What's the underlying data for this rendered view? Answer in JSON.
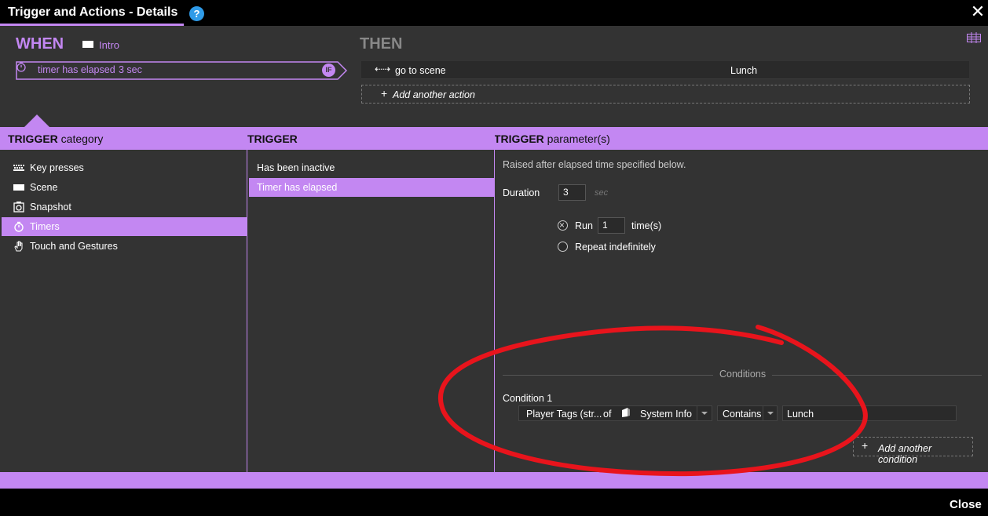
{
  "window": {
    "title": "Trigger and Actions - Details",
    "help_icon": "?",
    "close_icon": "✕"
  },
  "when": {
    "heading": "WHEN",
    "scene_name": "Intro",
    "trigger_label": "timer has elapsed",
    "trigger_value": "3 sec",
    "if_badge": "IF"
  },
  "then": {
    "heading": "THEN",
    "action_icon": "⇠⇢",
    "action_label": "go to scene",
    "action_value": "Lunch",
    "add_action": "Add another action"
  },
  "headers": {
    "category_bold": "TRIGGER",
    "category_rest": "category",
    "trigger_bold": "TRIGGER",
    "params_bold": "TRIGGER",
    "params_rest": "parameter(s)"
  },
  "categories": [
    {
      "label": "Key presses",
      "icon": "keyboard-icon",
      "selected": false
    },
    {
      "label": "Scene",
      "icon": "scene-icon",
      "selected": false
    },
    {
      "label": "Snapshot",
      "icon": "snapshot-icon",
      "selected": false
    },
    {
      "label": "Timers",
      "icon": "timer-icon",
      "selected": true
    },
    {
      "label": "Touch and Gestures",
      "icon": "hand-icon",
      "selected": false
    }
  ],
  "triggers": [
    {
      "label": "Has been inactive",
      "selected": false
    },
    {
      "label": "Timer has elapsed",
      "selected": true
    }
  ],
  "params": {
    "description": "Raised after elapsed time specified below.",
    "duration_label": "Duration",
    "duration_value": "3",
    "duration_unit": "sec",
    "run_label": "Run",
    "run_value": "1",
    "times_label": "time(s)",
    "repeat_label": "Repeat indefinitely",
    "run_selected": true
  },
  "conditions": {
    "title": "Conditions",
    "condition_label": "Condition 1",
    "field": "Player Tags (str...",
    "of": "of",
    "source": "System Info",
    "operator": "Contains",
    "value": "Lunch",
    "add_condition": "Add another condition"
  },
  "footer": {
    "close_label": "Close"
  },
  "colors": {
    "accent": "#c387f2",
    "panel": "#333333",
    "annotation": "#e8141c"
  }
}
